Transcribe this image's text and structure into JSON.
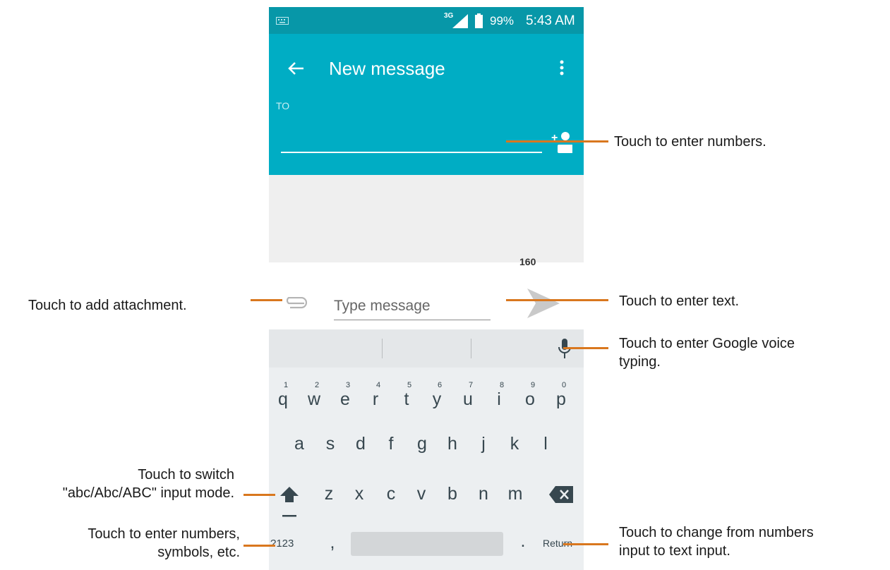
{
  "status_bar": {
    "network": "3G",
    "battery": "99%",
    "time": "5:43 AM"
  },
  "app_bar": {
    "title": "New message"
  },
  "recipient": {
    "label": "TO"
  },
  "compose": {
    "counter": "160",
    "placeholder": "Type message"
  },
  "keyboard": {
    "row1": [
      "q",
      "w",
      "e",
      "r",
      "t",
      "y",
      "u",
      "i",
      "o",
      "p"
    ],
    "row1_hints": [
      "1",
      "2",
      "3",
      "4",
      "5",
      "6",
      "7",
      "8",
      "9",
      "0"
    ],
    "row2": [
      "a",
      "s",
      "d",
      "f",
      "g",
      "h",
      "j",
      "k",
      "l"
    ],
    "row3": [
      "z",
      "x",
      "c",
      "v",
      "b",
      "n",
      "m"
    ],
    "symbols_key": "?123",
    "comma_key": ",",
    "period_key": ".",
    "return_key": "Return"
  },
  "callouts": {
    "enter_numbers": "Touch to enter numbers.",
    "add_attachment": "Touch to add attachment.",
    "enter_text": "Touch to enter text.",
    "voice_line1": "Touch to enter Google voice",
    "voice_line2": "typing.",
    "switch_line1": "Touch to switch",
    "switch_line2": "\"abc/Abc/ABC\" input mode.",
    "numbers_symbols_line1": "Touch to enter numbers,",
    "numbers_symbols_line2": "symbols, etc.",
    "change_input_line1": "Touch to change from numbers",
    "change_input_line2": "input to text input."
  },
  "colors": {
    "status_bar": "#0797a8",
    "app_bar": "#00adc4",
    "pointer": "#d9771e",
    "keyboard": "#eceff1"
  },
  "icons": [
    "keyboard-icon",
    "signal-icon",
    "battery-icon",
    "back-arrow-icon",
    "overflow-menu-icon",
    "add-contact-icon",
    "paperclip-icon",
    "send-icon",
    "microphone-icon",
    "shift-icon",
    "backspace-icon"
  ]
}
